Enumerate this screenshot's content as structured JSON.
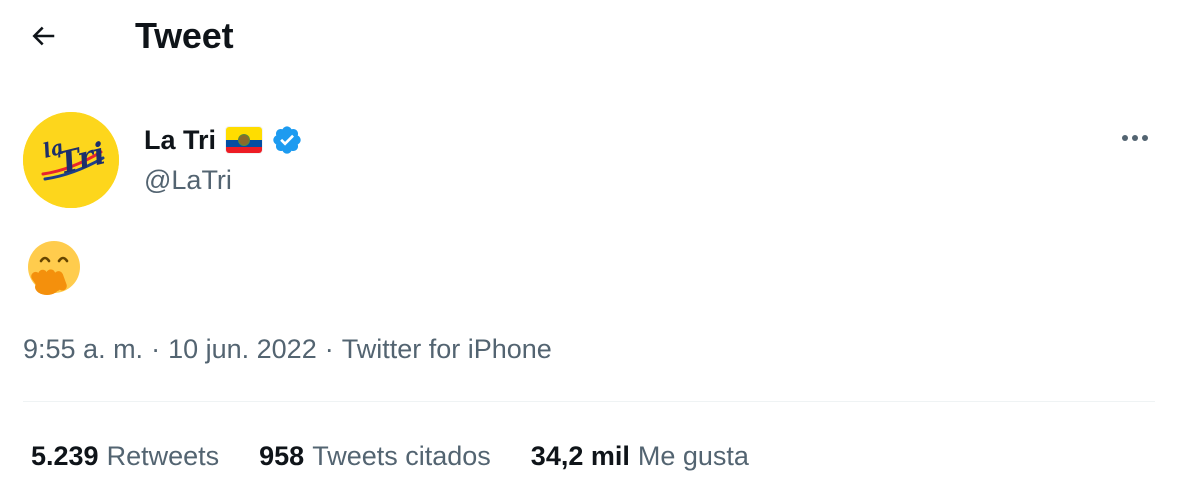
{
  "header": {
    "title": "Tweet",
    "back_icon": "arrow-left-icon"
  },
  "author": {
    "display_name": "La Tri",
    "flag": "ecuador-flag",
    "verified_icon": "verified-badge-icon",
    "username": "@LaTri",
    "avatar_text": "la Tri",
    "avatar_color": "#fdd61c"
  },
  "tweet": {
    "emoji": "🤭",
    "time": "9:55 a. m.",
    "date": "10 jun. 2022",
    "source": "Twitter for iPhone",
    "separator": "·"
  },
  "stats": [
    {
      "value": "5.239",
      "label": "Retweets"
    },
    {
      "value": "958",
      "label": "Tweets citados"
    },
    {
      "value": "34,2 mil",
      "label": "Me gusta"
    }
  ],
  "colors": {
    "text_primary": "#0f1419",
    "text_secondary": "#536471",
    "verified_blue": "#1d9bf0",
    "divider": "#eff3f4"
  }
}
